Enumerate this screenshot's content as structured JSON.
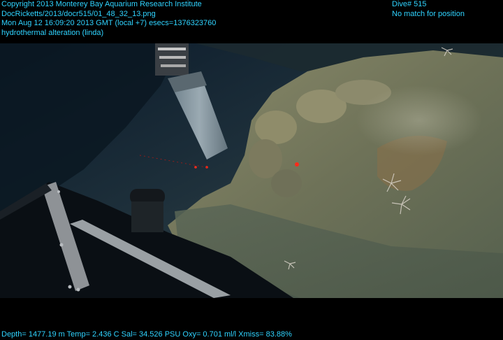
{
  "overlay": {
    "copyright": "Copyright 2013 Monterey Bay Aquarium Research Institute",
    "file_path": "DocRicketts/2013/docr515/01_48_32_13.png",
    "timestamp": "Mon Aug 12 16:09:20 2013 GMT (local +7)  esecs=1376323760",
    "description": "hydrothermal alteration (linda)",
    "dive": "Dive# 515",
    "position_status": "No match for position",
    "sensor_line": "Depth= 1477.19 m  Temp= 2.436 C  Sal= 34.526 PSU  Oxy= 0.701 ml/l  Xmiss= 83.88%"
  },
  "colors": {
    "overlay_text": "#2fd3ff",
    "background": "#000000"
  }
}
